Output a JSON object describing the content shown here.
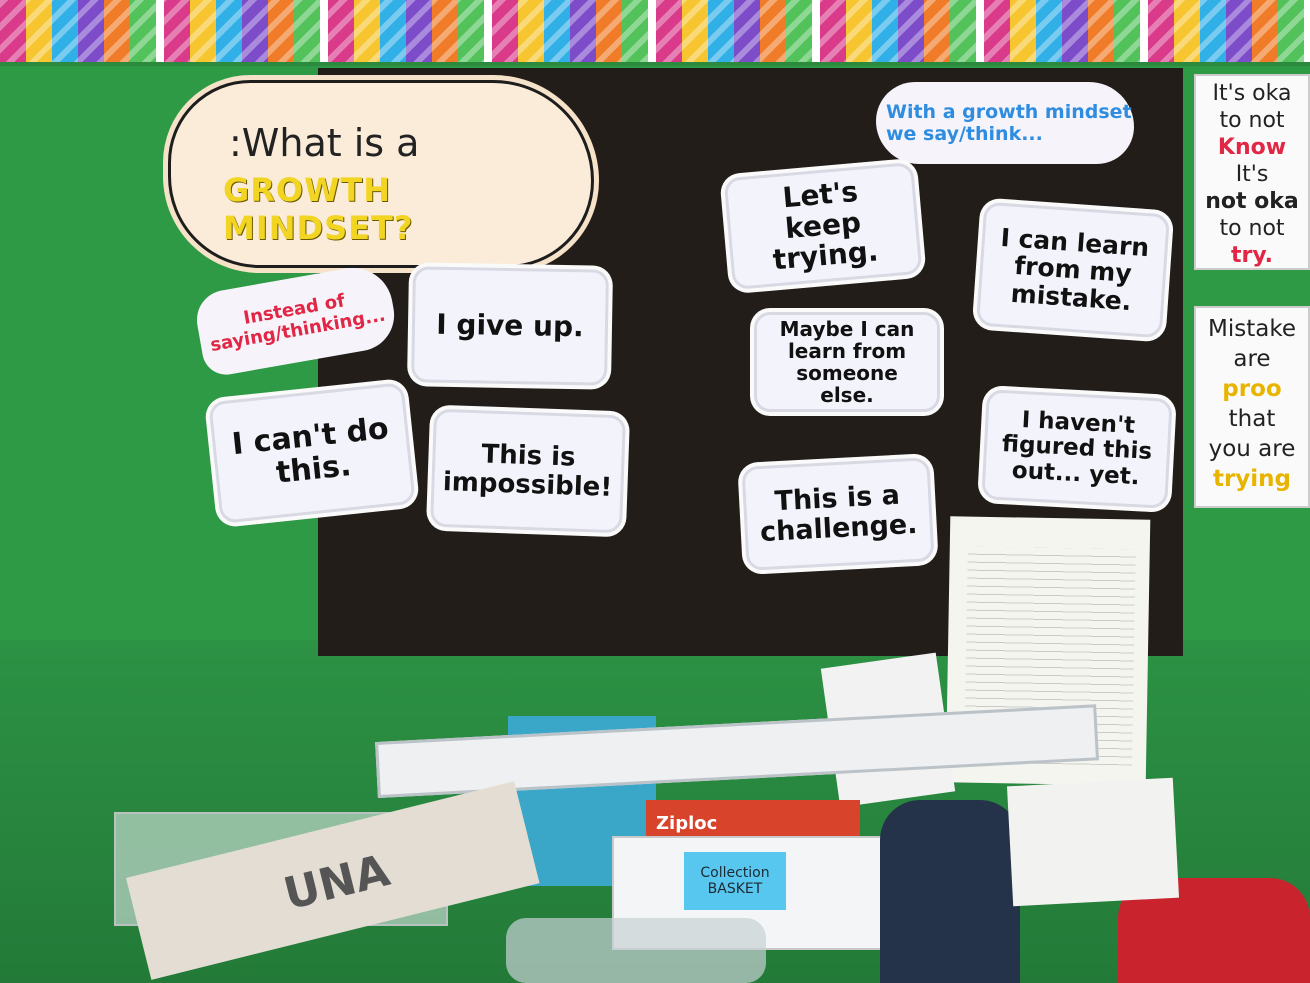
{
  "board": {
    "cloud": {
      "line1": ":What is a",
      "line2": "GROWTH MINDSET?"
    },
    "instead_label": "Instead of saying/thinking...",
    "growth_label": "With a growth mindset we say/think...",
    "fixed_bubbles": [
      "I give up.",
      "I can't do this.",
      "This is impossible!"
    ],
    "growth_bubbles": [
      "Let's keep trying.",
      "I can learn from my mistake.",
      "Maybe I can learn from someone else.",
      "I haven't figured this out... yet.",
      "This is a challenge."
    ]
  },
  "posters": {
    "poster1": [
      "It's oka",
      "to not",
      "Know",
      "It's",
      "not oka",
      "to not",
      "try."
    ],
    "poster2": [
      "Mistake",
      "are",
      "proo",
      "that",
      "you are",
      "trying"
    ]
  },
  "desk": {
    "ziploc_label": "Ziploc",
    "basket_label_1": "Collection",
    "basket_label_2": "BASKET",
    "bag_text": "UNA"
  },
  "colors": {
    "wall": "#2f9a45",
    "board": "#231d1a",
    "bubble": "#f3f4fb",
    "red_text": "#e12745",
    "blue_text": "#2e8de0",
    "yellow_text": "#f2d522"
  }
}
